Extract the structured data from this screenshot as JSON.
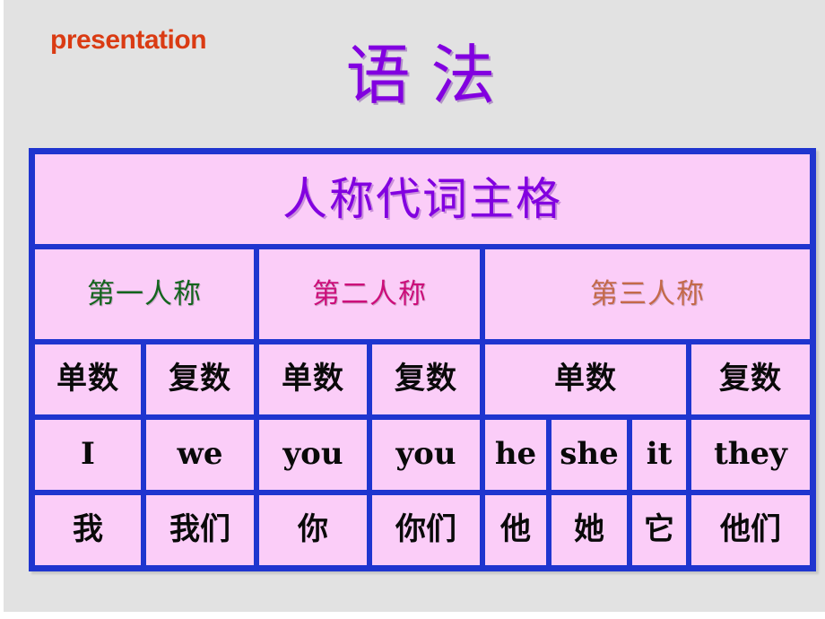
{
  "slide": {
    "kicker": "presentation",
    "title": "语    法",
    "background_color": "#e2e2e2",
    "kicker_color": "#da3b13",
    "title_color": "#8200e0"
  },
  "table": {
    "border_color": "#1f35cf",
    "cell_background": "#fbcdf8",
    "caption": "人称代词主格",
    "person_headers": [
      {
        "label": "第一人称",
        "color": "#14641e"
      },
      {
        "label": "第二人称",
        "color": "#cc0e7a"
      },
      {
        "label": "第三人称",
        "color": "#c4694a"
      }
    ],
    "number_row": [
      "单数",
      "复数",
      "单数",
      "复数",
      "单数",
      "复数"
    ],
    "english_row": [
      "I",
      "we",
      "you",
      "you",
      "he",
      "she",
      "it",
      "they"
    ],
    "chinese_row": [
      "我",
      "我们",
      "你",
      "你们",
      "他",
      "她",
      "它",
      "他们"
    ]
  }
}
